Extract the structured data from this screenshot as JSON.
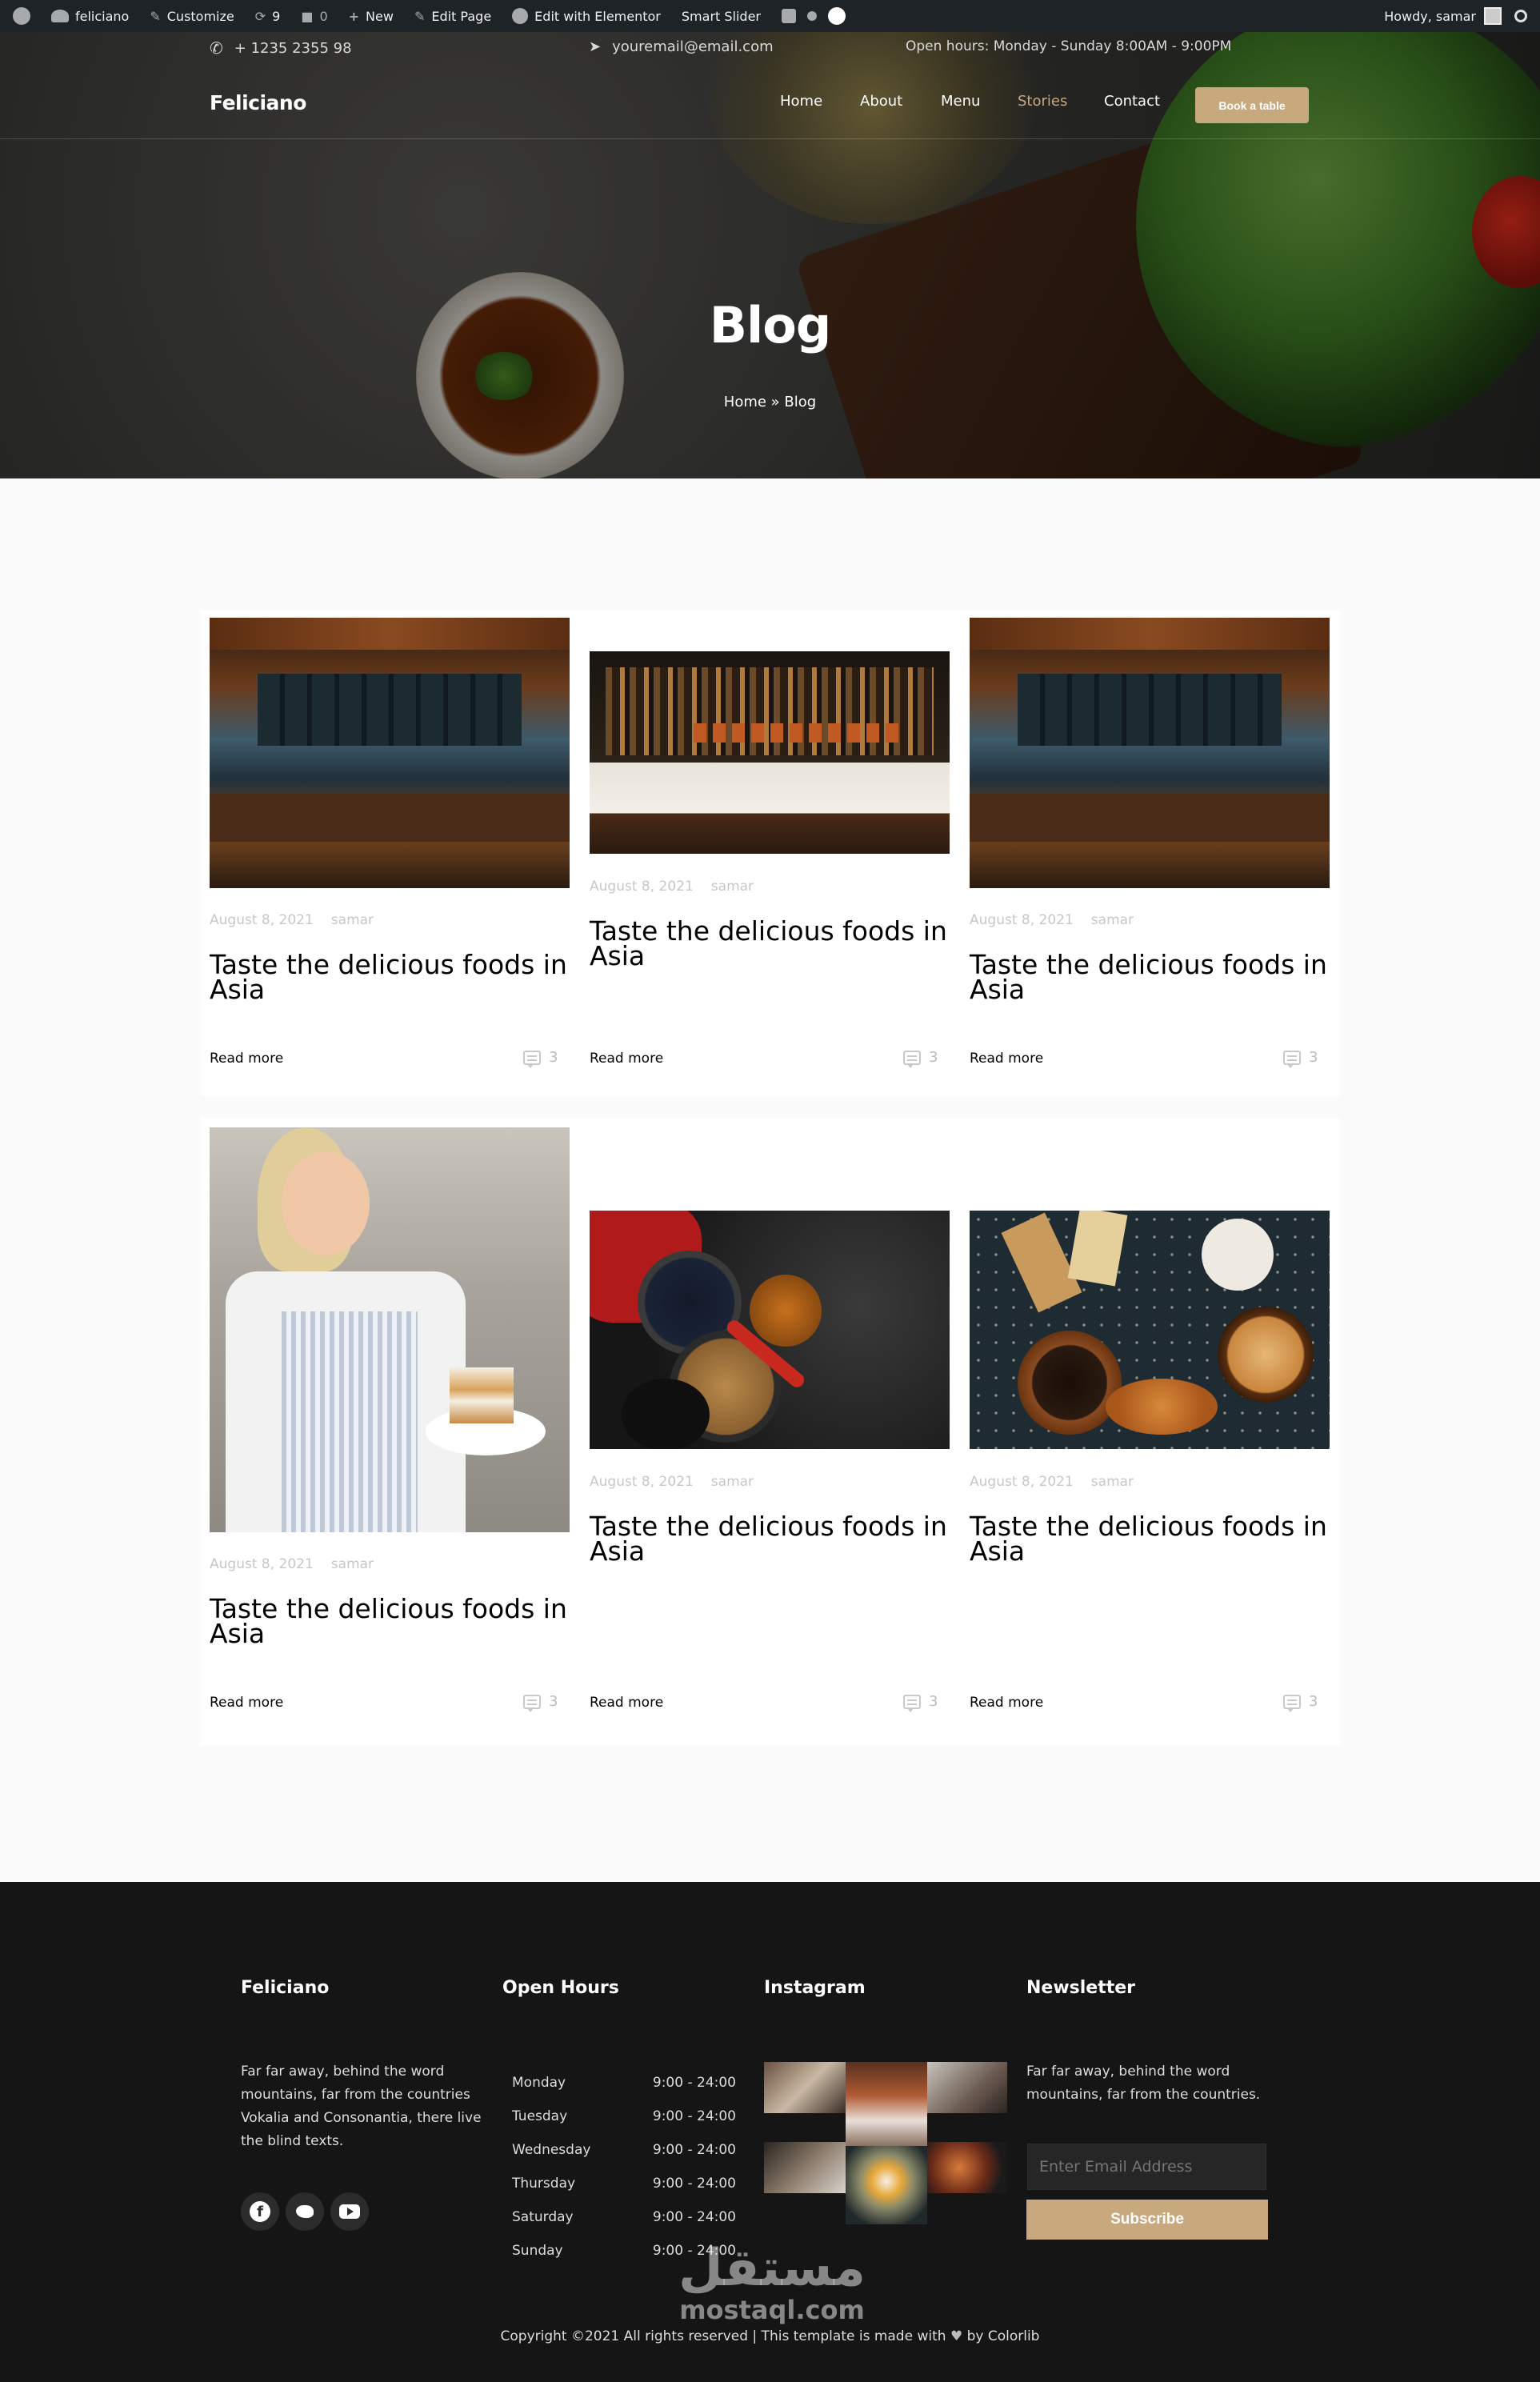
{
  "admin_bar": {
    "site": "feliciano",
    "customize": "Customize",
    "updates": "9",
    "comments": "0",
    "new": "New",
    "edit_page": "Edit Page",
    "elementor": "Edit with Elementor",
    "smart_slider": "Smart Slider",
    "howdy": "Howdy, samar"
  },
  "topbar": {
    "phone": "+ 1235 2355 98",
    "email": "youremail@email.com",
    "hours": "Open hours: Monday - Sunday 8:00AM - 9:00PM"
  },
  "nav": {
    "brand": "Feliciano",
    "items": [
      "Home",
      "About",
      "Menu",
      "Stories",
      "Contact"
    ],
    "active": "Stories",
    "book": "Book a table"
  },
  "hero": {
    "title": "Blog",
    "breadcrumb": "Home » Blog"
  },
  "posts": [
    {
      "date": "August 8, 2021",
      "author": "samar",
      "title": "Taste the delicious foods in Asia",
      "read_more": "Read more",
      "comments": "3",
      "image": "restaurant-bar"
    },
    {
      "date": "August 8, 2021",
      "author": "samar",
      "title": "Taste the delicious foods in Asia",
      "read_more": "Read more",
      "comments": "3",
      "image": "bar-shelves"
    },
    {
      "date": "August 8, 2021",
      "author": "samar",
      "title": "Taste the delicious foods in Asia",
      "read_more": "Read more",
      "comments": "3",
      "image": "restaurant-bar"
    },
    {
      "date": "August 8, 2021",
      "author": "samar",
      "title": "Taste the delicious foods in Asia",
      "read_more": "Read more",
      "comments": "3",
      "image": "chef-with-cake"
    },
    {
      "date": "August 8, 2021",
      "author": "samar",
      "title": "Taste the delicious foods in Asia",
      "read_more": "Read more",
      "comments": "3",
      "image": "spices"
    },
    {
      "date": "August 8, 2021",
      "author": "samar",
      "title": "Taste the delicious foods in Asia",
      "read_more": "Read more",
      "comments": "3",
      "image": "coffee-pastries"
    }
  ],
  "footer": {
    "about_title": "Feliciano",
    "about_text": "Far far away, behind the word mountains, far from the countries Vokalia and Consonantia, there live the blind texts.",
    "hours_title": "Open Hours",
    "hours": [
      {
        "day": "Monday",
        "time": "9:00 - 24:00"
      },
      {
        "day": "Tuesday",
        "time": "9:00 - 24:00"
      },
      {
        "day": "Wednesday",
        "time": "9:00 - 24:00"
      },
      {
        "day": "Thursday",
        "time": "9:00 - 24:00"
      },
      {
        "day": "Saturday",
        "time": "9:00 - 24:00"
      },
      {
        "day": "Sunday",
        "time": "9:00 - 24:00"
      }
    ],
    "instagram_title": "Instagram",
    "newsletter_title": "Newsletter",
    "newsletter_text": "Far far away, behind the word mountains, far from the countries.",
    "email_placeholder": "Enter Email Address",
    "subscribe": "Subscribe",
    "copyright": "Copyright ©2021 All rights reserved | This template is made with",
    "by": "by Colorlib",
    "social": [
      "facebook-icon",
      "twitter-icon",
      "youtube-icon"
    ]
  },
  "watermark": {
    "arabic": "مستقل",
    "latin": "mostaql.com"
  },
  "colors": {
    "accent": "#c8a97e",
    "footer_bg": "#151515",
    "admin_bg": "#1d2327"
  }
}
